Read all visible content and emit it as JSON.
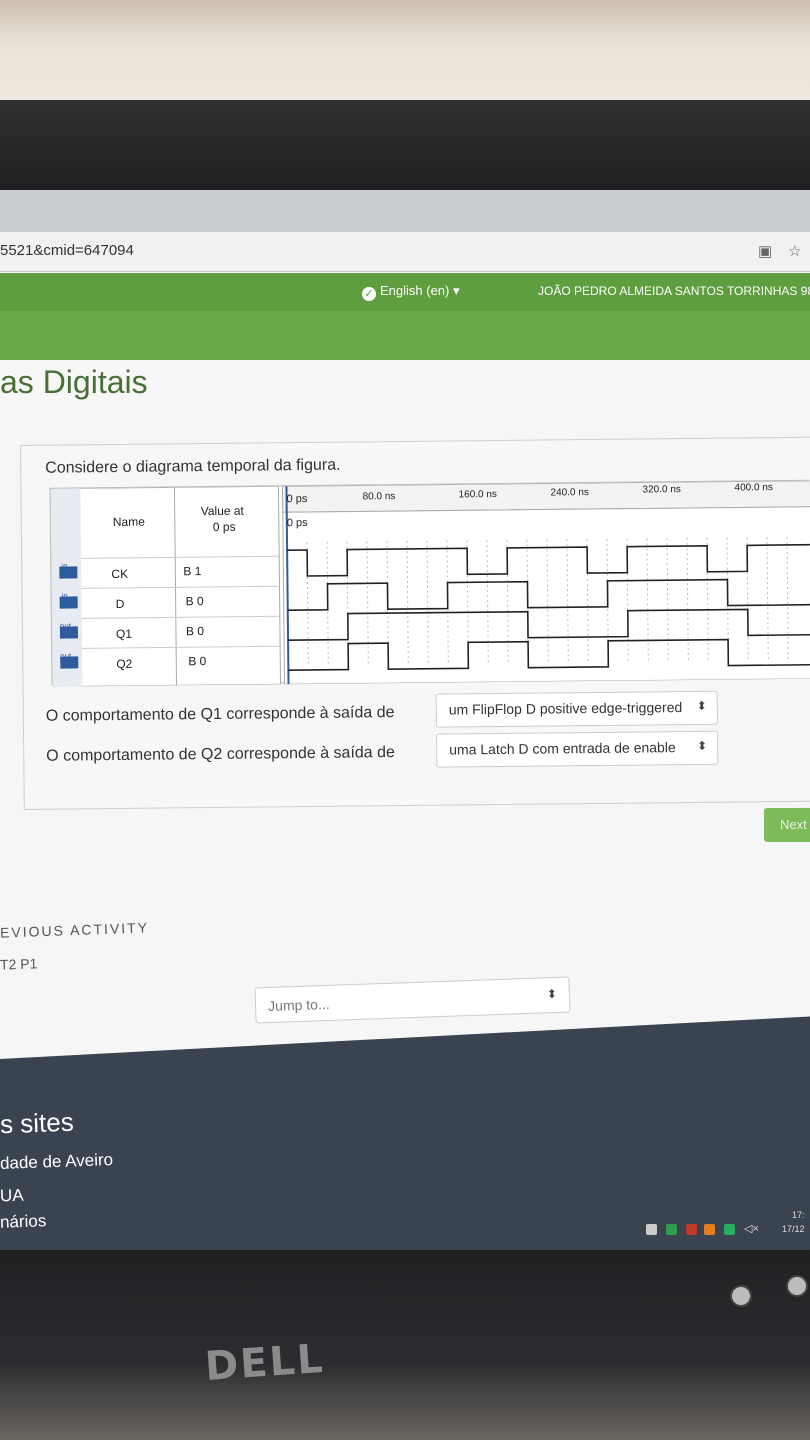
{
  "browser": {
    "url": "5521&cmid=647094"
  },
  "navbar": {
    "language": "English (en)",
    "language_caret": "▾",
    "user": "JOÃO PEDRO ALMEIDA SANTOS TORRINHAS 98..."
  },
  "course": {
    "title": "as Digitais"
  },
  "question": {
    "prompt": "Considere o diagrama temporal da figura.",
    "waveform": {
      "col_name": "Name",
      "col_value": "Value at",
      "col_value2": "0 ps",
      "time_ticks": [
        "0 ps",
        "80.0 ns",
        "160.0 ns",
        "240.0 ns",
        "320.0 ns",
        "400.0 ns"
      ],
      "cursor_label": "0 ps",
      "signals": [
        {
          "dir": "in",
          "name": "CK",
          "value": "B 1"
        },
        {
          "dir": "in",
          "name": "D",
          "value": "B 0"
        },
        {
          "dir": "out",
          "name": "Q1",
          "value": "B 0"
        },
        {
          "dir": "out",
          "name": "Q2",
          "value": "B 0"
        }
      ]
    },
    "items": [
      {
        "text": "O comportamento de Q1 corresponde à saída de",
        "answer": "um FlipFlop D positive edge-triggered"
      },
      {
        "text": "O comportamento de Q2 corresponde à saída de",
        "answer": "uma Latch D com entrada de enable"
      }
    ]
  },
  "nav": {
    "next_label": "Next",
    "prev_heading": "EVIOUS ACTIVITY",
    "prev_link": "T2 P1",
    "jump_placeholder": "Jump to..."
  },
  "footer": {
    "title": "s sites",
    "links": [
      "dade de Aveiro",
      "UA",
      "nários"
    ]
  },
  "taskbar": {
    "time": "17:",
    "date": "17/12"
  },
  "monitor": {
    "brand": "DELL"
  }
}
